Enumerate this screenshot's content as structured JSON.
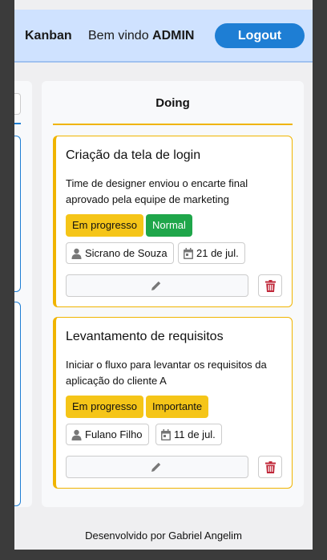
{
  "header": {
    "brand": "Kanban",
    "welcome_prefix": "Bem vindo",
    "welcome_user": "ADMIN",
    "logout_label": "Logout"
  },
  "column": {
    "title": "Doing",
    "accent_color": "#f0b400"
  },
  "cards": [
    {
      "title": "Criação da tela de login",
      "description": "Time de designer enviou o encarte final aprovado pela equipe de marketing",
      "status": "Em progresso",
      "priority": "Normal",
      "assignee": "Sicrano de Souza",
      "date": "21 de jul."
    },
    {
      "title": "Levantamento de requisitos",
      "description": "Iniciar o fluxo para levantar os requisitos da aplicação do cliente A",
      "status": "Em progresso",
      "priority": "Importante",
      "assignee": "Fulano Filho",
      "date": "11 de jul."
    }
  ],
  "footer": {
    "credit": "Desenvolvido por Gabriel Angelim"
  },
  "colors": {
    "header_bg": "#cfe2ff",
    "primary": "#1e7ed4",
    "warning": "#f5c518",
    "success": "#1fa64a",
    "danger": "#c0283a"
  },
  "icons": [
    "person-icon",
    "calendar-icon",
    "pencil-icon",
    "trash-icon"
  ]
}
